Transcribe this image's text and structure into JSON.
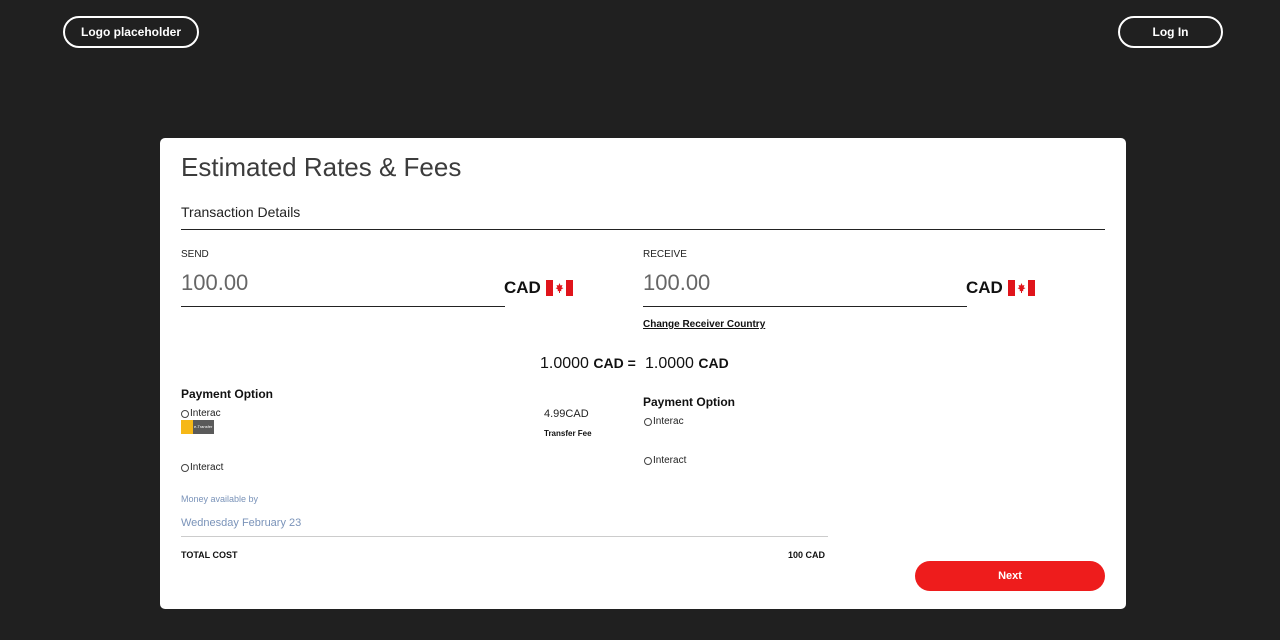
{
  "header": {
    "logo_label": "Logo placeholder",
    "login_label": "Log In"
  },
  "card": {
    "title": "Estimated Rates & Fees",
    "subtitle": "Transaction Details",
    "send": {
      "label": "SEND",
      "amount": "100.00",
      "currency": "CAD"
    },
    "receive": {
      "label": "RECEIVE",
      "amount": "100.00",
      "currency": "CAD",
      "change_country_label": "Change Receiver Country"
    },
    "rate": {
      "left_value": "1.0000",
      "left_currency": "CAD =",
      "right_value": "1.0000",
      "right_currency": "CAD"
    },
    "send_payment": {
      "title": "Payment Option",
      "options": [
        "Interac",
        "Interact"
      ]
    },
    "fee": {
      "amount": "4.99CAD",
      "label": "Transfer Fee"
    },
    "receive_payment": {
      "title": "Payment Option",
      "options": [
        "Interac",
        "Interact"
      ]
    },
    "availability": {
      "label": "Money available by",
      "date": "Wednesday February 23"
    },
    "total": {
      "label": "TOTAL COST",
      "value": "100 CAD"
    },
    "next_label": "Next",
    "colors": {
      "accent": "#ee1c1c",
      "background": "#202020",
      "availability_text": "#7a93b9"
    },
    "icons": {
      "flag": "canada-flag-icon",
      "badge": "interac-badge-icon"
    }
  }
}
